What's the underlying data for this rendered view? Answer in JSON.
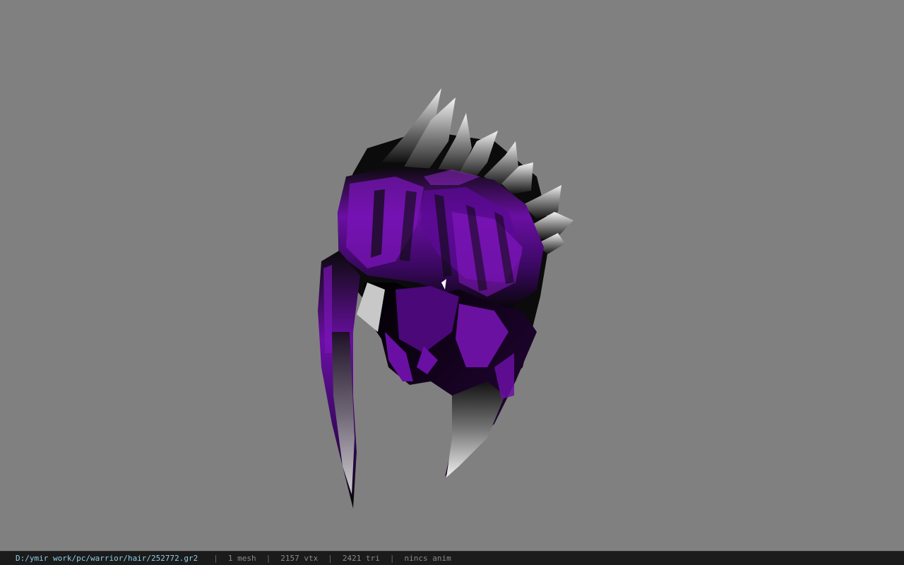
{
  "viewer": {
    "background_color": "#808080",
    "model_colors": {
      "hair_main": "#6a0fa3",
      "hair_dark": "#0a0a0a",
      "hair_tips": "#e8e8e8"
    }
  },
  "status_bar": {
    "file_path": "D:/ymir work/pc/warrior/hair/252772.gr2",
    "separator": "|",
    "mesh_count": "1 mesh",
    "vertex_count": "2157 vtx",
    "triangle_count": "2421 tri",
    "animation": "nincs anim"
  }
}
